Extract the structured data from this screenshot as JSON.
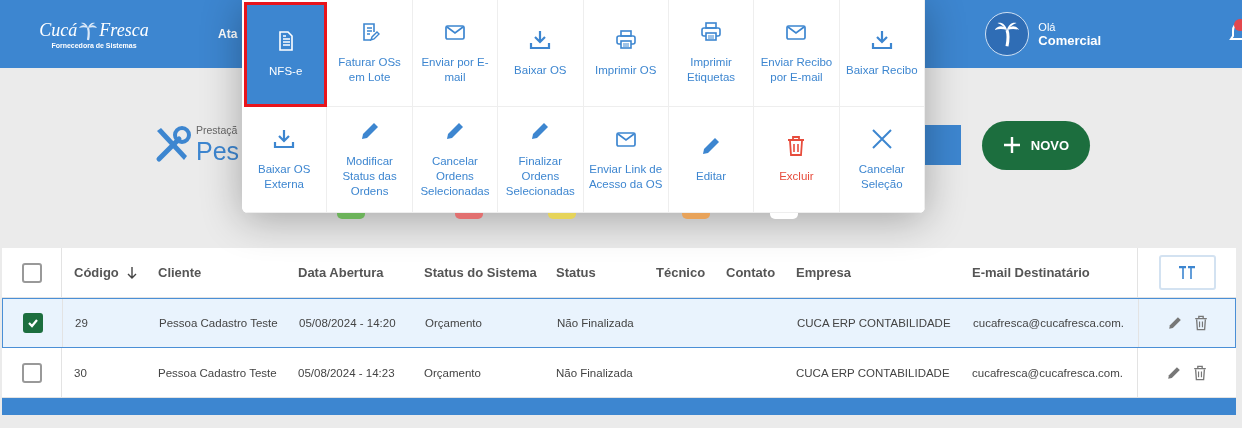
{
  "header": {
    "logo": {
      "word_left": "Cucá",
      "word_right": "Fresca",
      "tagline": "Fornecedora de Sistemas"
    },
    "nav": [
      "Ata"
    ],
    "user": {
      "greeting": "Olá",
      "name": "Comercial"
    },
    "notifications": {
      "unread": true
    }
  },
  "page": {
    "subtitle": "Prestaçã",
    "title": "Pes",
    "new_button": "NOVO"
  },
  "legend": [
    {
      "color": "#6cb35a"
    },
    {
      "color": "#e27070"
    },
    {
      "color": "#e6d45a"
    },
    {
      "color": "#e8a35a"
    },
    {
      "color": "#ffffff"
    }
  ],
  "action_menu": [
    {
      "label": "NFS-e",
      "kind": "invoice",
      "selected": true,
      "danger": false
    },
    {
      "label": "Faturar OSs em Lote",
      "kind": "edit-doc",
      "selected": false,
      "danger": false
    },
    {
      "label": "Enviar por E-mail",
      "kind": "mail",
      "selected": false,
      "danger": false
    },
    {
      "label": "Baixar OS",
      "kind": "download",
      "selected": false,
      "danger": false
    },
    {
      "label": "Imprimir OS",
      "kind": "print",
      "selected": false,
      "danger": false
    },
    {
      "label": "Imprimir Etiquetas",
      "kind": "print",
      "selected": false,
      "danger": false
    },
    {
      "label": "Enviar Recibo por E-mail",
      "kind": "mail",
      "selected": false,
      "danger": false
    },
    {
      "label": "Baixar Recibo",
      "kind": "download",
      "selected": false,
      "danger": false
    },
    {
      "label": "Baixar OS Externa",
      "kind": "download",
      "selected": false,
      "danger": false
    },
    {
      "label": "Modificar Status das Ordens",
      "kind": "pencil",
      "selected": false,
      "danger": false
    },
    {
      "label": "Cancelar Ordens Selecionadas",
      "kind": "pencil",
      "selected": false,
      "danger": false
    },
    {
      "label": "Finalizar Ordens Selecionadas",
      "kind": "pencil",
      "selected": false,
      "danger": false
    },
    {
      "label": "Enviar Link de Acesso da OS",
      "kind": "mail",
      "selected": false,
      "danger": false
    },
    {
      "label": "Editar",
      "kind": "pencil",
      "selected": false,
      "danger": false
    },
    {
      "label": "Excluir",
      "kind": "trash",
      "selected": false,
      "danger": true
    },
    {
      "label": "Cancelar Seleção",
      "kind": "close",
      "selected": false,
      "danger": false
    }
  ],
  "table": {
    "all_checked": false,
    "columns": [
      {
        "label": "Código",
        "sorted": true
      },
      {
        "label": "Cliente"
      },
      {
        "label": "Data Abertura"
      },
      {
        "label": "Status do Sistema"
      },
      {
        "label": "Status"
      },
      {
        "label": "Técnico"
      },
      {
        "label": "Contato"
      },
      {
        "label": "Empresa"
      },
      {
        "label": "E-mail Destinatário"
      }
    ],
    "rows": [
      {
        "selected": true,
        "cells": [
          "29",
          "Pessoa Cadastro Teste",
          "05/08/2024 - 14:20",
          "Orçamento",
          "Não Finalizada",
          null,
          null,
          "CUCA ERP CONTABILIDADE",
          "cucafresca@cucafresca.com."
        ]
      },
      {
        "selected": false,
        "cells": [
          "30",
          "Pessoa Cadastro Teste",
          "05/08/2024 - 14:23",
          "Orçamento",
          "Não Finalizada",
          null,
          null,
          "CUCA ERP CONTABILIDADE",
          "cucafresca@cucafresca.com."
        ]
      }
    ]
  }
}
